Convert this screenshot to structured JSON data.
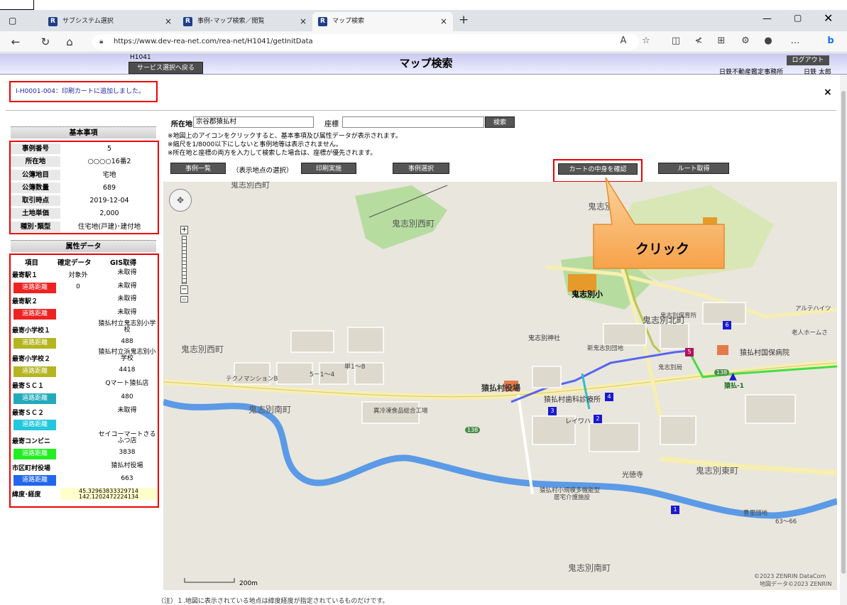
{
  "browser": {
    "tabs": [
      {
        "label": "サブシステム選択",
        "icon": "rea-favicon"
      },
      {
        "label": "事例･マップ検索／閲覧",
        "icon": "rea-favicon"
      },
      {
        "label": "マップ検索",
        "icon": "rea-favicon",
        "active": true
      }
    ],
    "url": "https://www.dev-rea-net.com/rea-net/H1041/getInitData"
  },
  "header": {
    "screen_code": "H1041",
    "back_button": "サービス選択へ戻る",
    "title": "マップ検索",
    "logout_button": "ログアウト",
    "office": "日鉄不動産鑑定事務所",
    "user": "日鉄 太郎"
  },
  "message": {
    "text": "I-H0001-004：印刷カートに追加しました。",
    "close": "×"
  },
  "basic_info": {
    "title": "基本事項",
    "rows": [
      {
        "label": "事例番号",
        "value": "5"
      },
      {
        "label": "所在地",
        "value": "○○○○16番2"
      },
      {
        "label": "公簿地目",
        "value": "宅地"
      },
      {
        "label": "公簿数量",
        "value": "689"
      },
      {
        "label": "取引時点",
        "value": "2019-12-04"
      },
      {
        "label": "土地単価",
        "value": "2,000"
      },
      {
        "label": "種別･類型",
        "value": "住宅地(戸建)･建付地"
      }
    ]
  },
  "attr_data": {
    "title": "属性データ",
    "headers": [
      "項目",
      "確定データ",
      "GIS取得"
    ],
    "road_label": "道路距離",
    "rows": [
      {
        "label": "最寄駅１",
        "fixed": "対象外",
        "gis": "未取得"
      },
      {
        "label": "道路距離",
        "road": true,
        "color": "#ee2222",
        "fixed": "0",
        "gis": "未取得"
      },
      {
        "label": "最寄駅２",
        "fixed": "",
        "gis": "未取得"
      },
      {
        "label": "道路距離",
        "road": true,
        "color": "#ee2222",
        "fixed": "",
        "gis": "未取得"
      },
      {
        "label": "最寄小学校１",
        "fixed": "",
        "gis": "猿払村立鬼志別小学校",
        "tall": true
      },
      {
        "label": "道路距離",
        "road": true,
        "color": "#b5b522",
        "fixed": "",
        "gis": "488"
      },
      {
        "label": "最寄小学校２",
        "fixed": "",
        "gis": "猿払村立浜鬼志別小学校",
        "tall": true
      },
      {
        "label": "道路距離",
        "road": true,
        "color": "#b5b522",
        "fixed": "",
        "gis": "4418"
      },
      {
        "label": "最寄ＳＣ１",
        "fixed": "",
        "gis": "Qマート猿払店"
      },
      {
        "label": "道路距離",
        "road": true,
        "color": "#22aabb",
        "fixed": "",
        "gis": "480"
      },
      {
        "label": "最寄ＳＣ２",
        "fixed": "",
        "gis": "未取得"
      },
      {
        "label": "道路距離",
        "road": true,
        "color": "#22c8dd",
        "fixed": "",
        "gis": ""
      },
      {
        "label": "最寄コンビニ",
        "fixed": "",
        "gis": "セイコーマートさるふつ店",
        "tall": true
      },
      {
        "label": "道路距離",
        "road": true,
        "color": "#22ee22",
        "fixed": "",
        "gis": "3838"
      },
      {
        "label": "市区町村役場",
        "fixed": "",
        "gis": "猿払村役場"
      },
      {
        "label": "道路距離",
        "road": true,
        "color": "#2266ee",
        "fixed": "",
        "gis": "663"
      }
    ],
    "coord_label": "緯度･経度",
    "lat": "45.32963833329714",
    "lon": "142.1202472224134"
  },
  "search": {
    "location_label": "所在地",
    "location_value": "宗谷郡猿払村",
    "coord_label": "座標",
    "coord_value": "",
    "search_button": "検索",
    "notes": [
      "※地図上のアイコンをクリックすると、基本事項及び属性データが表示されます。",
      "※縮尺を1/8000以下にしないと事例地等は表示されません。",
      "※所在地と座標の両方を入力して検索した場合は、座標が優先されます。"
    ],
    "btn_list": "事例一覧",
    "display_note": "（表示地点の選択）",
    "btn_print": "印刷実施",
    "btn_select": "事例選択",
    "btn_cart": "カートの中身を確認",
    "btn_route": "ルート取得"
  },
  "callout": "クリック",
  "map": {
    "labels": {
      "oniwest_top": "鬼志別西町",
      "oniwest": "鬼志別西町",
      "oniwest_left": "鬼志別西町",
      "oni_top": "鬼志別",
      "school": "鬼志別小",
      "north": "鬼志別北町",
      "south": "鬼志別南町",
      "south2": "鬼志別南町",
      "east": "鬼志別東町",
      "hoikusho": "鬼志別保育所",
      "danchi": "新鬼志別団地",
      "shrine": "鬼志別神社",
      "post": "鬼志別局",
      "hospital": "猿払村国保病院",
      "office": "猿払村役場",
      "clinic": "猿払村歯科診療所",
      "factory": "異冷凍食品総合工場",
      "mansion": "テクノマンションB",
      "addr1": "単1～8",
      "addr2": "5－1～4",
      "reiwa": "レイワハ",
      "temple": "光徳寺",
      "care": "猿払村小規模多機能型",
      "care2": "居宅介護施設",
      "toyosato": "豊里団地",
      "addr3": "63～66",
      "alpine": "アルテハイツ",
      "rojin": "老人ホームさ",
      "saruhutsu": "猿払-1",
      "route": "138",
      "scale": "200m",
      "copyright1": "©2023 ZENRIN DataCom",
      "copyright2": "地図データ©2023 ZENRIN"
    },
    "markers": [
      "1",
      "2",
      "3",
      "4",
      "5",
      "6"
    ]
  },
  "footnote": "（注）１.地図に表示されている地点は緯度経度が指定されているものだけです。"
}
